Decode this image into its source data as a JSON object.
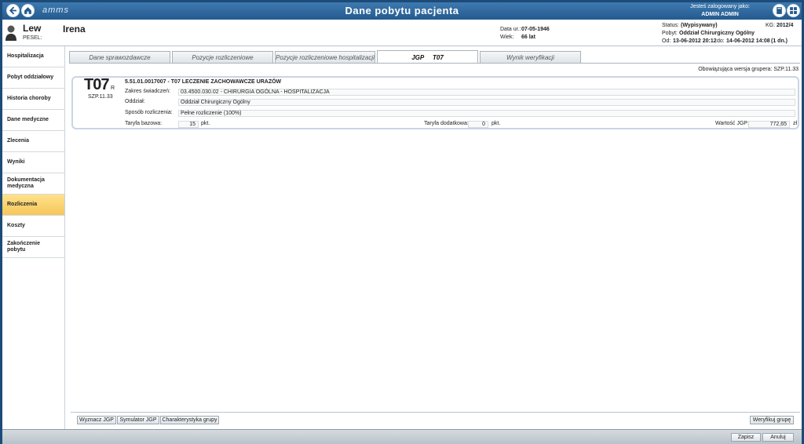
{
  "app": {
    "logo": "amms",
    "title": "Dane pobytu pacjenta"
  },
  "login": {
    "label": "Jesteś zalogowany jako:",
    "user": "ADMIN ADMIN"
  },
  "patient": {
    "last_name": "Lew",
    "first_name": "Irena",
    "pesel_label": "PESEL:",
    "dob_label": "Data ur.:",
    "dob": "07-05-1946",
    "age_label": "Wiek:",
    "age": "66 lat"
  },
  "stay": {
    "status_label": "Status:",
    "status": "(Wypisywany)",
    "kg_label": "KG:",
    "kg": "2012/4",
    "pobyt_label": "Pobyt:",
    "pobyt": "Oddział Chirurgiczny Ogólny",
    "from_label": "Od:",
    "from": "13-06-2012  20:12",
    "to_label": "do:",
    "to": "14-06-2012  14:08",
    "duration": "(1 dn.)"
  },
  "sidebar": {
    "items": [
      {
        "label": "Hospitalizacja",
        "active": false
      },
      {
        "label": "Pobyt oddziałowy",
        "active": false
      },
      {
        "label": "Historia choroby",
        "active": false
      },
      {
        "label": "Dane medyczne",
        "active": false
      },
      {
        "label": "Zlecenia",
        "active": false
      },
      {
        "label": "Wyniki",
        "active": false
      },
      {
        "label": "Dokumentacja medyczna",
        "active": false
      },
      {
        "label": "Rozliczenia",
        "active": true
      },
      {
        "label": "Koszty",
        "active": false
      },
      {
        "label": "Zakończenie pobytu",
        "active": false
      }
    ]
  },
  "tabs": [
    {
      "label": "Dane sprawozdawcze"
    },
    {
      "label": "Pozycje rozliczeniowe"
    },
    {
      "label": "Pozycje rozliczeniowe hospitalizacji"
    },
    {
      "label": "JGP     T07",
      "active": true
    },
    {
      "label": "Wynik weryfikacji"
    }
  ],
  "version": {
    "label": "Obowiązująca wersja grupera:",
    "value": "SZP.11.33"
  },
  "group": {
    "code": "T07",
    "suffix": "R",
    "version": "SZP.11.33",
    "title": "5.51.01.0017007 - T07 LECZENIE ZACHOWAWCZE URAZÓW",
    "zakres_label": "Zakres świadczeń:",
    "zakres": "03.4500.030.02 - CHIRURGIA OGÓLNA -  HOSPITALIZACJA",
    "oddzial_label": "Oddział:",
    "oddzial": "Oddział Chirurgiczny Ogólny",
    "sposob_label": "Sposób rozliczenia:",
    "sposob": "Pełne rozliczenie (100%)",
    "taryfa_bazowa_label": "Taryfa bazowa:",
    "taryfa_bazowa": "15",
    "pkt": "pkt.",
    "taryfa_dodatkowa_label": "Taryfa dodatkowa:",
    "taryfa_dodatkowa": "0",
    "wartosc_label": "Wartość JGP:",
    "wartosc": "772,65",
    "currency": "zł"
  },
  "buttons": {
    "wyznacz": "Wyznacz JGP",
    "symulator": "Symulator JGP",
    "charakterystyka": "Charakterystyka grupy",
    "weryfikuj": "Weryfikuj grupę",
    "zapisz": "Zapisz",
    "anuluj": "Anuluj"
  }
}
